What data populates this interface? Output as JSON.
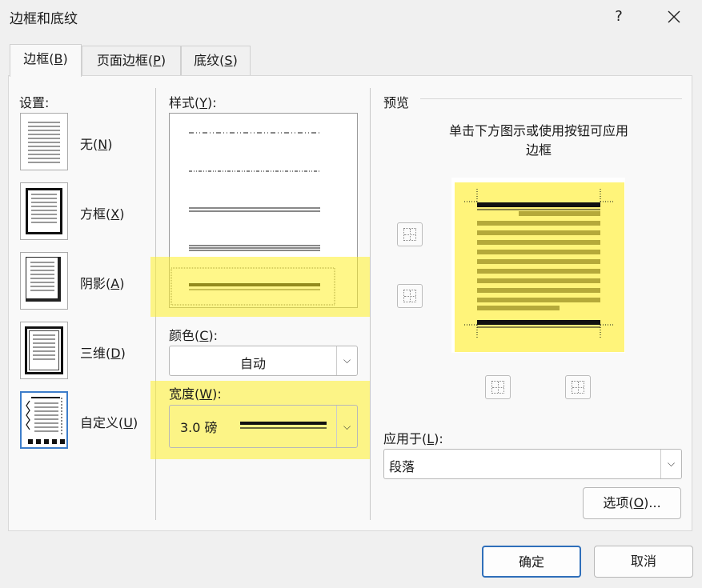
{
  "window": {
    "title": "边框和底纹",
    "help": "?",
    "close": "✕"
  },
  "tabs": [
    {
      "label": "边框(",
      "key": "B",
      "suffix": ")"
    },
    {
      "label": "页面边框(",
      "key": "P",
      "suffix": ")"
    },
    {
      "label": "底纹(",
      "key": "S",
      "suffix": ")"
    }
  ],
  "settings": {
    "heading": "设置:",
    "items": [
      {
        "label": "无(",
        "key": "N",
        "suffix": ")"
      },
      {
        "label": "方框(",
        "key": "X",
        "suffix": ")"
      },
      {
        "label": "阴影(",
        "key": "A",
        "suffix": ")"
      },
      {
        "label": "三维(",
        "key": "D",
        "suffix": ")"
      },
      {
        "label": "自定义(",
        "key": "U",
        "suffix": ")"
      }
    ]
  },
  "style": {
    "label": "样式(",
    "key": "Y",
    "suffix": "):"
  },
  "color": {
    "label": "颜色(",
    "key": "C",
    "suffix": "):",
    "value": "自动"
  },
  "width": {
    "label": "宽度(",
    "key": "W",
    "suffix": "):",
    "value": "3.0 磅"
  },
  "preview": {
    "heading": "预览",
    "hint_line1": "单击下方图示或使用按钮可应用",
    "hint_line2": "边框"
  },
  "apply_to": {
    "label": "应用于(",
    "key": "L",
    "suffix": "):",
    "value": "段落"
  },
  "buttons": {
    "options": "选项(",
    "options_key": "O",
    "options_suffix": ")...",
    "ok": "确定",
    "cancel": "取消"
  },
  "colors": {
    "highlight": "#fff055",
    "accent": "#2f6fba"
  }
}
